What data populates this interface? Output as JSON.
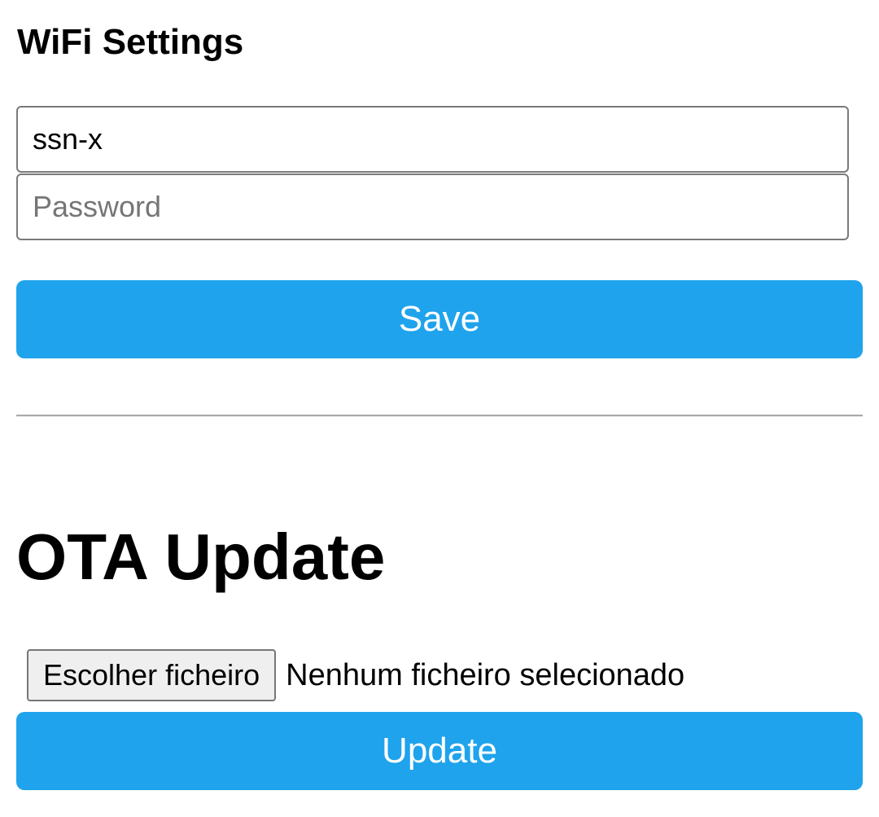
{
  "wifi": {
    "title": "WiFi Settings",
    "ssid_value": "ssn-x",
    "password_placeholder": "Password",
    "save_label": "Save"
  },
  "ota": {
    "title": "OTA Update",
    "choose_file_label": "Escolher ficheiro",
    "file_status": "Nenhum ficheiro selecionado",
    "update_label": "Update"
  },
  "colors": {
    "button_blue": "#1fa3ec",
    "button_text": "#ffffff",
    "divider": "#a9a9a9"
  }
}
